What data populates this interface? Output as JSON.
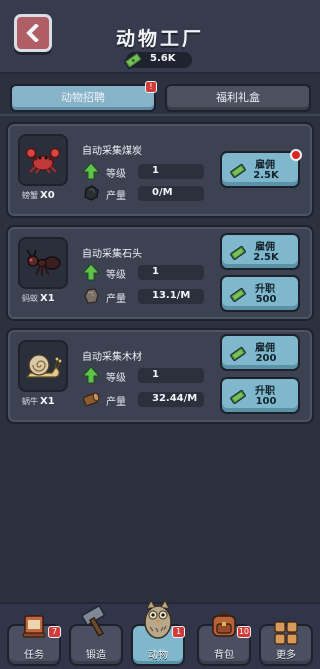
{
  "header": {
    "title": "动物工厂",
    "cash": "5.6K",
    "back_icon": "back-arrow-icon",
    "cash_icon": "cash-icon"
  },
  "tabs": [
    {
      "label": "动物招聘",
      "active": true,
      "badge": "!"
    },
    {
      "label": "福利礼盒",
      "active": false
    }
  ],
  "labels": {
    "level": "等级",
    "output": "产量"
  },
  "cards": [
    {
      "animal_icon": "crab-icon",
      "name": "螃蟹",
      "count": "X0",
      "task": "自动采集煤炭",
      "level": "1",
      "resource_icon": "coal-icon",
      "output": "0/M",
      "buttons": [
        {
          "label": "雇佣",
          "cost": "2.5K",
          "dot": true
        }
      ]
    },
    {
      "animal_icon": "ant-icon",
      "name": "蚂蚁",
      "count": "X1",
      "task": "自动采集石头",
      "level": "1",
      "resource_icon": "stone-icon",
      "output": "13.1/M",
      "buttons": [
        {
          "label": "雇佣",
          "cost": "2.5K",
          "dot": false
        },
        {
          "label": "升职",
          "cost": "500",
          "dot": false
        }
      ]
    },
    {
      "animal_icon": "snail-icon",
      "name": "蜗牛",
      "count": "X1",
      "task": "自动采集木材",
      "level": "1",
      "resource_icon": "wood-icon",
      "output": "32.44/M",
      "buttons": [
        {
          "label": "雇佣",
          "cost": "200",
          "dot": false
        },
        {
          "label": "升职",
          "cost": "100",
          "dot": false
        }
      ]
    }
  ],
  "nav": [
    {
      "label": "任务",
      "icon": "scroll-icon",
      "badge": "7",
      "active": false
    },
    {
      "label": "锻造",
      "icon": "hammer-icon",
      "badge": "",
      "active": false
    },
    {
      "label": "动物",
      "icon": "owl-icon",
      "badge": "1",
      "active": true
    },
    {
      "label": "背包",
      "icon": "backpack-icon",
      "badge": "10",
      "active": false
    },
    {
      "label": "更多",
      "icon": "grid-icon",
      "badge": "",
      "active": false
    }
  ],
  "colors": {
    "background": "#2c3140",
    "card": "#3c4252",
    "accent": "#7fb8cc",
    "badge": "#d33b3b",
    "back_button": "#b05e66"
  }
}
